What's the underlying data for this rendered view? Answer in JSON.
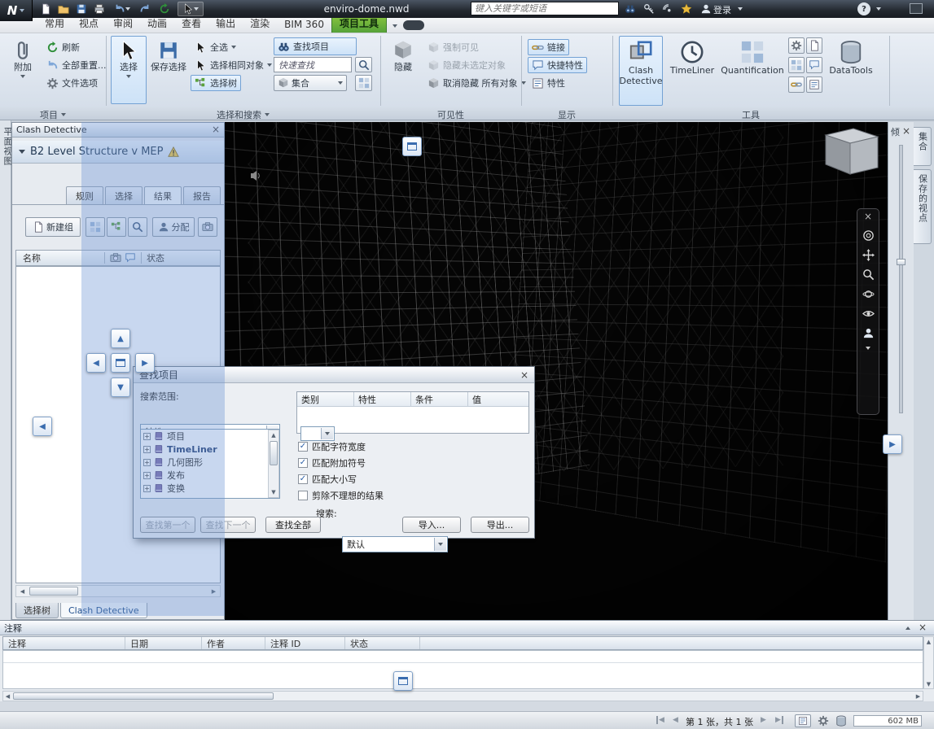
{
  "titlebar": {
    "app_logo": "N",
    "title": "enviro-dome.nwd",
    "search_placeholder": "键入关键字或短语",
    "signin_label": "登录"
  },
  "ribbon": {
    "tabs": [
      "常用",
      "视点",
      "审阅",
      "动画",
      "查看",
      "输出",
      "渲染",
      "BIM 360",
      "项目工具"
    ],
    "groups": {
      "project": {
        "label": "项目",
        "attach": "附加",
        "refresh": "刷新",
        "reset_all": "全部重置...",
        "file_options": "文件选项"
      },
      "select_search": {
        "label": "选择和搜索",
        "select": "选择",
        "save_selection": "保存选择",
        "select_all": "全选",
        "select_same": "选择相同对象",
        "selection_tree": "选择树",
        "find_items": "查找项目",
        "quick_find": "快速查找",
        "sets": "集合"
      },
      "visibility": {
        "label": "可见性",
        "hide": "隐藏",
        "require": "强制可见",
        "hide_unselected": "隐藏未选定对象",
        "unhide_all": "取消隐藏 所有对象"
      },
      "display": {
        "label": "显示",
        "links": "链接",
        "quick_properties": "快捷特性",
        "properties": "特性"
      },
      "tools": {
        "label": "工具",
        "clash": "Clash Detective",
        "timeliner": "TimeLiner",
        "quantification": "Quantification",
        "datatools": "DataTools"
      }
    }
  },
  "left_tab": "平面视图",
  "clash_panel": {
    "title": "Clash Detective",
    "test_name": "B2 Level Structure v MEP",
    "tabs": [
      "规则",
      "选择",
      "结果",
      "报告"
    ],
    "new_group_label": "新建组",
    "assign_label": "分配",
    "name_col": "名称",
    "status_col": "状态",
    "bottom_tabs": [
      "选择树",
      "Clash Detective"
    ]
  },
  "find_dialog": {
    "title": "查找项目",
    "scope_label": "搜索范围:",
    "scope_value": "特性",
    "tree_items": [
      "项目",
      "TimeLiner",
      "几何图形",
      "发布",
      "变换"
    ],
    "grid_columns": [
      "类别",
      "特性",
      "条件",
      "值"
    ],
    "checkboxes": [
      {
        "label": "匹配字符宽度",
        "mark": "✓"
      },
      {
        "label": "匹配附加符号",
        "mark": "✓"
      },
      {
        "label": "匹配大小写",
        "mark": "✓"
      },
      {
        "label": "剪除不理想的结果",
        "mark": ""
      }
    ],
    "search_label": "搜索:",
    "search_value": "默认",
    "find_first": "查找第一个",
    "find_next": "查找下一个",
    "find_all": "查找全部",
    "import_label": "导入...",
    "export_label": "导出..."
  },
  "right_side": {
    "tilt_label": "倾",
    "tabs": [
      "集合",
      "保存的视点"
    ]
  },
  "comments_panel": {
    "title": "注释",
    "columns": [
      "注释",
      "日期",
      "作者",
      "注释 ID",
      "状态"
    ]
  },
  "statusbar": {
    "page_info": "第 1 张，共 1 张",
    "memory": "602 MB"
  }
}
